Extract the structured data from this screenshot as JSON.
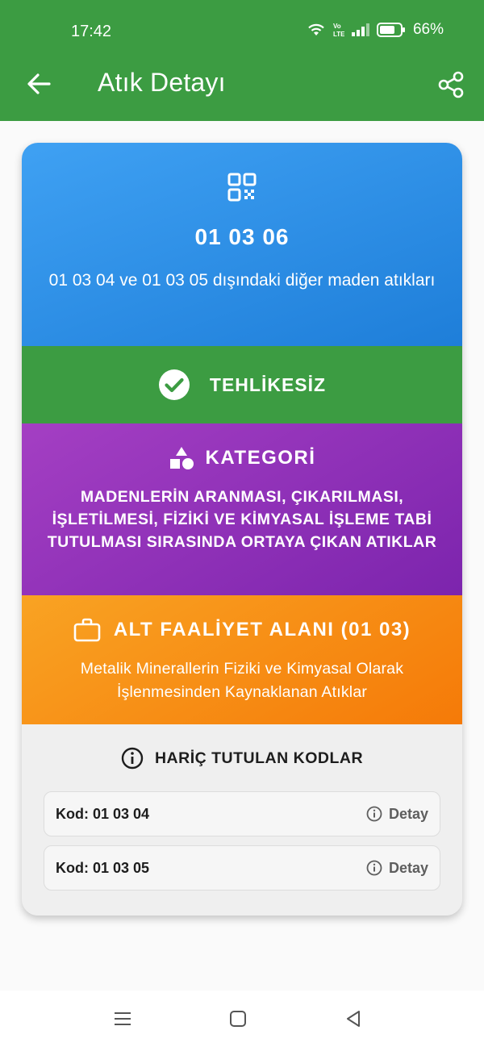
{
  "status_bar": {
    "time": "17:42",
    "battery": "66%"
  },
  "app_bar": {
    "title": "Atık Detayı"
  },
  "code_section": {
    "code": "01 03 06",
    "description": "01 03 04 ve 01 03 05 dışındaki diğer maden atıkları"
  },
  "hazard_section": {
    "label": "TEHLİKESİZ"
  },
  "category_section": {
    "title": "KATEGORİ",
    "text": "MADENLERİN ARANMASI, ÇIKARILMASI, İŞLETİLMESİ, FİZİKİ VE KİMYASAL İŞLEME TABİ TUTULMASI SIRASINDA ORTAYA ÇIKAN ATIKLAR"
  },
  "subactivity_section": {
    "title": "ALT FAALİYET ALANI (01 03)",
    "text": "Metalik Minerallerin Fiziki ve Kimyasal Olarak İşlenmesinden Kaynaklanan Atıklar"
  },
  "excluded_section": {
    "title": "HARİÇ TUTULAN KODLAR",
    "rows": [
      {
        "code": "Kod: 01 03 04",
        "detail": "Detay"
      },
      {
        "code": "Kod: 01 03 05",
        "detail": "Detay"
      }
    ]
  },
  "colors": {
    "app_bar": "#3c9c42",
    "code_section": "#2b8fe6",
    "hazard_section": "#3c9c42",
    "category_section": "#9032b8",
    "subactivity_section": "#f78f15",
    "excluded_section": "#efefef"
  },
  "icons": {
    "back": "arrow-left-icon",
    "share": "share-icon",
    "code": "qr-code-icon",
    "hazard": "check-circle-icon",
    "category": "shapes-icon",
    "subactivity": "briefcase-icon",
    "excluded": "info-icon",
    "detail": "info-icon"
  }
}
